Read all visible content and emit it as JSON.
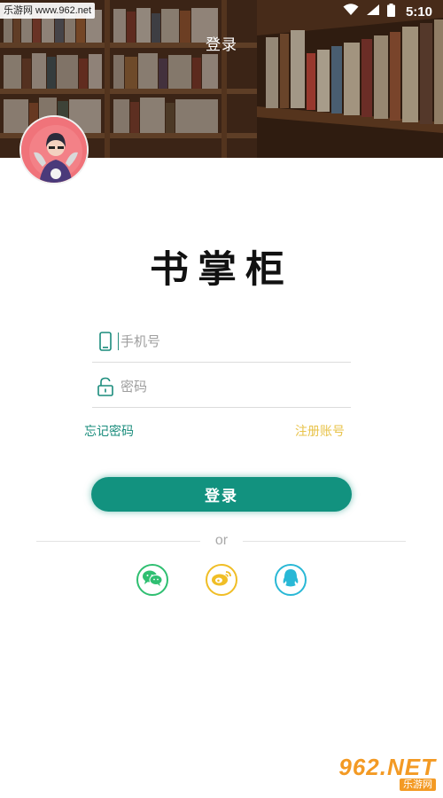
{
  "status_bar": {
    "time": "5:10",
    "icons": [
      "wifi-icon",
      "signal-icon",
      "battery-icon"
    ]
  },
  "watermark_top": "乐游网 www.962.net",
  "header": {
    "title": "登录"
  },
  "logo": {
    "text": "书掌柜"
  },
  "form": {
    "phone_placeholder": "手机号",
    "password_placeholder": "密码",
    "forgot_label": "忘记密码",
    "register_label": "注册账号",
    "login_label": "登录"
  },
  "divider": {
    "text": "or"
  },
  "social": [
    {
      "name": "wechat",
      "icon": "wechat-icon",
      "color": "#2fbf71"
    },
    {
      "name": "weibo",
      "icon": "weibo-icon",
      "color": "#f0be26"
    },
    {
      "name": "qq",
      "icon": "qq-icon",
      "color": "#29b8d6"
    }
  ],
  "colors": {
    "primary": "#12927f",
    "link": "#1a8c7c",
    "register": "#e8c34a"
  },
  "watermark_bottom": {
    "main": "962.NET",
    "sub": "乐游网"
  }
}
